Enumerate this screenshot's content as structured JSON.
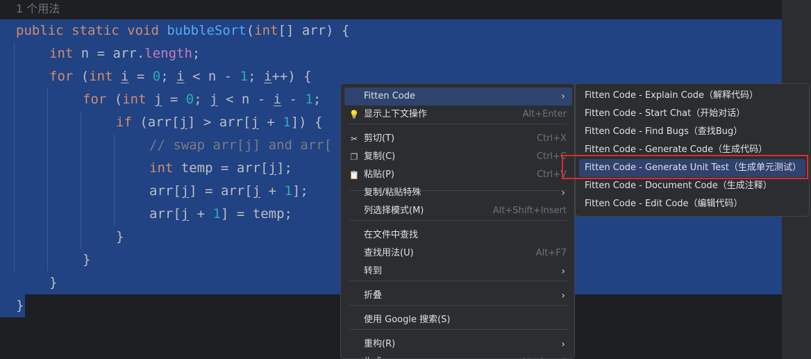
{
  "editor": {
    "usages": "1 个用法",
    "code_lines": [
      [
        {
          "t": "public static void ",
          "c": "kw"
        },
        {
          "t": "bubbleSort",
          "c": "fn"
        },
        {
          "t": "(",
          "c": ""
        },
        {
          "t": "int",
          "c": "kw"
        },
        {
          "t": "[] arr) {",
          "c": ""
        }
      ],
      [
        {
          "t": "int ",
          "c": "kw"
        },
        {
          "t": "n = arr.",
          "c": ""
        },
        {
          "t": "length",
          "c": "fld"
        },
        {
          "t": ";",
          "c": ""
        }
      ],
      [
        {
          "t": "for ",
          "c": "kw"
        },
        {
          "t": "(",
          "c": ""
        },
        {
          "t": "int ",
          "c": "kw"
        },
        {
          "t": "i",
          "c": "u"
        },
        {
          "t": " = ",
          "c": ""
        },
        {
          "t": "0",
          "c": "num"
        },
        {
          "t": "; ",
          "c": ""
        },
        {
          "t": "i",
          "c": "u"
        },
        {
          "t": " < n - ",
          "c": ""
        },
        {
          "t": "1",
          "c": "num"
        },
        {
          "t": "; ",
          "c": ""
        },
        {
          "t": "i",
          "c": "u"
        },
        {
          "t": "++) {",
          "c": ""
        }
      ],
      [
        {
          "t": "for ",
          "c": "kw"
        },
        {
          "t": "(",
          "c": ""
        },
        {
          "t": "int ",
          "c": "kw"
        },
        {
          "t": "j",
          "c": "u"
        },
        {
          "t": " = ",
          "c": ""
        },
        {
          "t": "0",
          "c": "num"
        },
        {
          "t": "; ",
          "c": ""
        },
        {
          "t": "j",
          "c": "u"
        },
        {
          "t": " < n - ",
          "c": ""
        },
        {
          "t": "i",
          "c": "u"
        },
        {
          "t": " - ",
          "c": ""
        },
        {
          "t": "1",
          "c": "num"
        },
        {
          "t": ";",
          "c": ""
        }
      ],
      [
        {
          "t": "if ",
          "c": "kw"
        },
        {
          "t": "(arr[",
          "c": ""
        },
        {
          "t": "j",
          "c": "u"
        },
        {
          "t": "] > arr[",
          "c": ""
        },
        {
          "t": "j",
          "c": "u"
        },
        {
          "t": " + ",
          "c": ""
        },
        {
          "t": "1",
          "c": "num"
        },
        {
          "t": "]) {",
          "c": ""
        }
      ],
      [
        {
          "t": "// swap arr[j] and arr[",
          "c": "cm"
        }
      ],
      [
        {
          "t": "int ",
          "c": "kw"
        },
        {
          "t": "temp = arr[",
          "c": ""
        },
        {
          "t": "j",
          "c": "u"
        },
        {
          "t": "];",
          "c": ""
        }
      ],
      [
        {
          "t": "arr[",
          "c": ""
        },
        {
          "t": "j",
          "c": "u"
        },
        {
          "t": "] = arr[",
          "c": ""
        },
        {
          "t": "j",
          "c": "u"
        },
        {
          "t": " + ",
          "c": ""
        },
        {
          "t": "1",
          "c": "num"
        },
        {
          "t": "];",
          "c": ""
        }
      ],
      [
        {
          "t": "arr[",
          "c": ""
        },
        {
          "t": "j",
          "c": "u"
        },
        {
          "t": " + ",
          "c": ""
        },
        {
          "t": "1",
          "c": "num"
        },
        {
          "t": "] = temp;",
          "c": ""
        }
      ],
      [
        {
          "t": "}",
          "c": ""
        }
      ],
      [
        {
          "t": "}",
          "c": ""
        }
      ],
      [
        {
          "t": "}",
          "c": ""
        }
      ],
      [
        {
          "t": "}",
          "c": ""
        }
      ]
    ]
  },
  "context_menu": {
    "items": [
      {
        "label": "Fitten Code",
        "submenu": true,
        "highlighted": true
      },
      {
        "icon": "lightbulb-icon",
        "glyph": "💡",
        "label": "显示上下文操作",
        "shortcut": "Alt+Enter"
      },
      {
        "icon": "scissors-icon",
        "glyph": "✂",
        "label": "剪切(T)",
        "shortcut": "Ctrl+X"
      },
      {
        "icon": "copy-icon",
        "glyph": "❐",
        "label": "复制(C)",
        "shortcut": "Ctrl+C"
      },
      {
        "icon": "clipboard-icon",
        "glyph": "📋",
        "label": "粘贴(P)",
        "shortcut": "Ctrl+V"
      },
      {
        "label": "复制/粘贴特殊",
        "submenu": true
      },
      {
        "label": "列选择模式(M)",
        "shortcut": "Alt+Shift+Insert"
      },
      {
        "label": "在文件中查找"
      },
      {
        "label": "查找用法(U)",
        "shortcut": "Alt+F7"
      },
      {
        "label": "转到",
        "submenu": true
      },
      {
        "label": "折叠",
        "submenu": true
      },
      {
        "label": "使用 Google 搜索(S)"
      },
      {
        "label": "重构(R)",
        "submenu": true
      },
      {
        "label": "生成...",
        "shortcut": "Alt+Insert"
      }
    ],
    "arrow_glyph": "›"
  },
  "fitten_submenu": {
    "items": [
      {
        "label": "Fitten Code - Explain Code（解释代码）"
      },
      {
        "label": "Fitten Code - Start Chat（开始对话）"
      },
      {
        "label": "Fitten Code - Find Bugs（查找Bug）"
      },
      {
        "label": "Fitten Code - Generate Code（生成代码）"
      },
      {
        "label": "Fitten Code - Generate Unit Test（生成单元测试）",
        "highlighted": true
      },
      {
        "label": "Fitten Code - Document Code（生成注释）"
      },
      {
        "label": "Fitten Code - Edit Code（编辑代码）"
      }
    ]
  },
  "colors": {
    "selection": "#214283",
    "menu_highlight": "#2e436e",
    "annotation_box": "#e5292d"
  }
}
